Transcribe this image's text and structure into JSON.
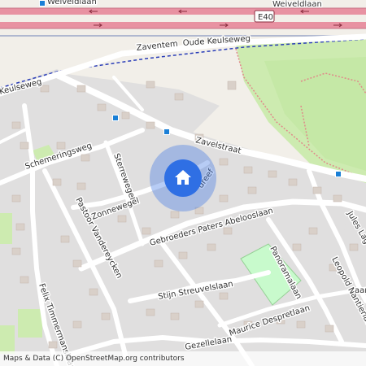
{
  "map": {
    "colors": {
      "land": "#f2efe9",
      "residential": "#e0dfdf",
      "park": "#c8facc",
      "grass": "#cdebb0",
      "motorway": "#e892a2",
      "marker": "#2f6fe4",
      "bus_stop": "#1a7fd6"
    },
    "labels": {
      "weiveldlaan": "Weiveldlaan",
      "e40": "E40",
      "zaventem": "Zaventem",
      "oude_keulseweg": "Oude Keulseweg",
      "keulseweg": "Keulseweg",
      "zavelstraat": "Zavelstraat",
      "schemeringsweg": "Schemeringsweg",
      "sterrewegel": "Sterrewegel",
      "zonnewegel": "Zonnewegel",
      "pastoor_vanderey": "Pastoor Vandereycken",
      "paters_abeloos": "Gebroeders Paters Abelooslaan",
      "felix_timmermans": "Felix Timmermanslaan",
      "stijn_streuvels": "Stijn Streuvelslaan",
      "panoramalaan": "Panoramalaan",
      "leopold_nantier": "Leopold Nantierlaan",
      "jules_lagae": "Jules Lag",
      "gezellelaan": "Gezellelaan",
      "maurice_despret": "Maurice Despretlaan",
      "dreef": "dreef",
      "aan": "aan"
    },
    "marker_icon": "home-icon",
    "attribution": "Maps & Data (C) OpenStreetMap.org contributors"
  }
}
